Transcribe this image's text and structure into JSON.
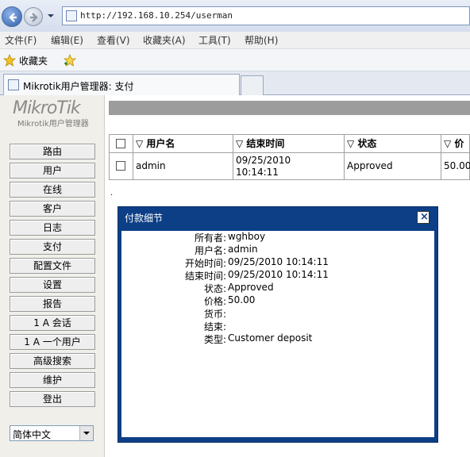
{
  "browser": {
    "url": "http://192.168.10.254/userman",
    "menu": [
      "文件(F)",
      "编辑(E)",
      "查看(V)",
      "收藏夹(A)",
      "工具(T)",
      "帮助(H)"
    ],
    "favorites_label": "收藏夹",
    "tab_title": "Mikrotik用户管理器: 支付"
  },
  "logo": {
    "brand": "MikroTik",
    "subtitle": "Mikrotik用户管理器"
  },
  "sidebar": {
    "items": [
      "路由",
      "用户",
      "在线",
      "客户",
      "日志",
      "支付",
      "配置文件",
      "设置",
      "报告",
      "1 A 会话",
      "1 A 一个用户",
      "高级搜索",
      "维护",
      "登出"
    ],
    "language": "简体中文"
  },
  "table": {
    "headers": [
      "▽ 用户名",
      "▽ 结束时间",
      "▽ 状态",
      "▽ 价"
    ],
    "rows": [
      {
        "username": "admin",
        "end_time_date": "09/25/2010",
        "end_time_time": "10:14:11",
        "status": "Approved",
        "price": "50.00"
      }
    ],
    "footer_dot": "."
  },
  "modal": {
    "title": "付款细节",
    "close": "×",
    "fields": [
      {
        "label": "所有者:",
        "value": "wghboy"
      },
      {
        "label": "用户名:",
        "value": "admin"
      },
      {
        "label": "开始时间:",
        "value": "09/25/2010 10:14:11"
      },
      {
        "label": "结束时间:",
        "value": "09/25/2010 10:14:11"
      },
      {
        "label": "状态:",
        "value": "Approved"
      },
      {
        "label": "价格:",
        "value": "50.00"
      },
      {
        "label": "货币:",
        "value": ""
      },
      {
        "label": "结束:",
        "value": ""
      },
      {
        "label": "类型:",
        "value": "Customer deposit"
      }
    ]
  },
  "colors": {
    "modal_frame": "#0d3f86",
    "header_bar": "#9c9c9c",
    "sidebar_bg": "#f0efe9"
  }
}
